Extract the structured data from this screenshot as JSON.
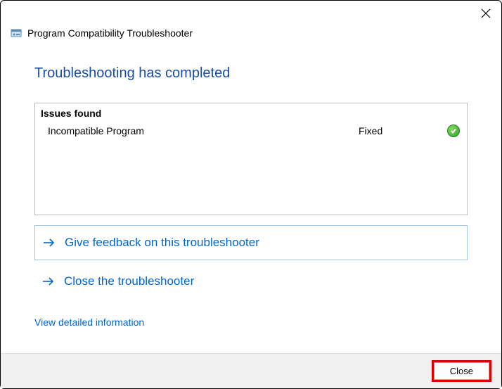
{
  "app_title": "Program Compatibility Troubleshooter",
  "heading": "Troubleshooting has completed",
  "issues": {
    "header": "Issues found",
    "rows": [
      {
        "name": "Incompatible Program",
        "status": "Fixed"
      }
    ]
  },
  "actions": {
    "feedback": "Give feedback on this troubleshooter",
    "close_troubleshooter": "Close the troubleshooter"
  },
  "detail_link": "View detailed information",
  "footer": {
    "close_button": "Close"
  }
}
